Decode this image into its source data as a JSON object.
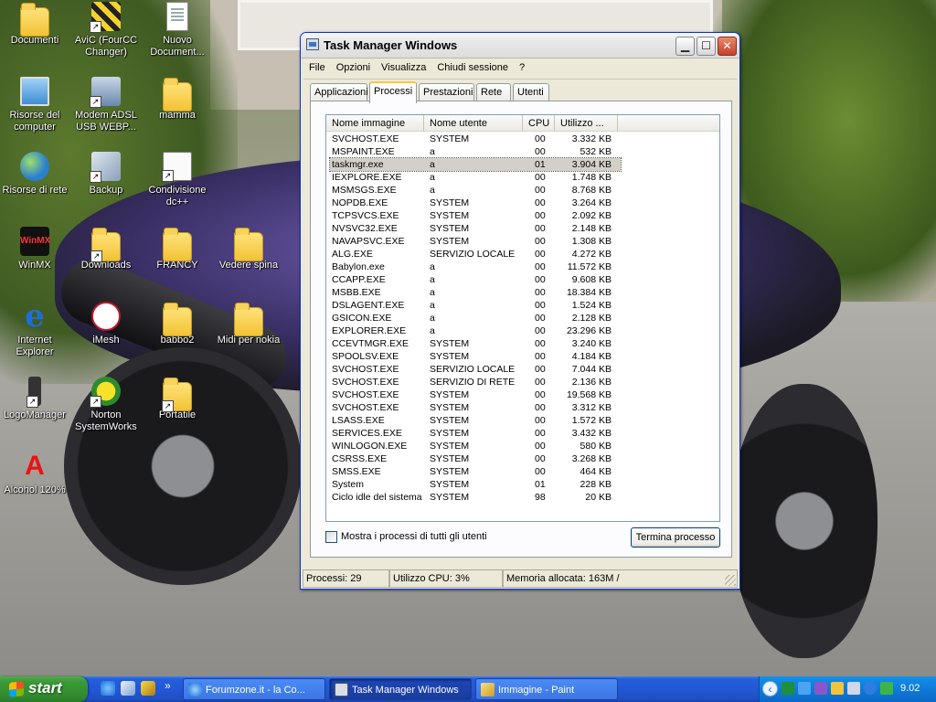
{
  "desktop": {
    "icons": [
      {
        "label": "Documenti",
        "icon": "folder-documents-icon"
      },
      {
        "label": "AviC (FourCC Changer)",
        "icon": "avic-icon"
      },
      {
        "label": "Nuovo Document...",
        "icon": "text-document-icon"
      },
      {
        "label": "Risorse del computer",
        "icon": "my-computer-icon"
      },
      {
        "label": "Modem ADSL USB WEBP...",
        "icon": "modem-icon"
      },
      {
        "label": "mamma",
        "icon": "folder-icon"
      },
      {
        "label": "Risorse di rete",
        "icon": "network-places-icon"
      },
      {
        "label": "Backup",
        "icon": "backup-icon"
      },
      {
        "label": "Condivisione dc++",
        "icon": "share-icon"
      },
      {
        "label": "WinMX",
        "icon": "winmx-icon"
      },
      {
        "label": "Downloads",
        "icon": "folder-icon"
      },
      {
        "label": "FRANCY",
        "icon": "folder-icon"
      },
      {
        "label": "Vedere spina",
        "icon": "folder-icon"
      },
      {
        "label": "Internet Explorer",
        "icon": "internet-explorer-icon"
      },
      {
        "label": "iMesh",
        "icon": "imesh-icon"
      },
      {
        "label": "babbo2",
        "icon": "folder-icon"
      },
      {
        "label": "Midi per nokia",
        "icon": "folder-icon"
      },
      {
        "label": "LogoManager",
        "icon": "phone-icon"
      },
      {
        "label": "Norton SystemWorks",
        "icon": "norton-icon"
      },
      {
        "label": "Portatile",
        "icon": "folder-icon"
      },
      {
        "label": "Alcohol 120%",
        "icon": "alcohol-icon"
      }
    ]
  },
  "window": {
    "title": "Task Manager Windows",
    "menu": [
      "File",
      "Opzioni",
      "Visualizza",
      "Chiudi sessione",
      "?"
    ],
    "tabs": [
      "Applicazioni",
      "Processi",
      "Prestazioni",
      "Rete",
      "Utenti"
    ],
    "active_tab": "Processi",
    "columns": [
      "Nome immagine",
      "Nome utente",
      "CPU",
      "Utilizzo ..."
    ],
    "processes": [
      {
        "name": "SVCHOST.EXE",
        "user": "SYSTEM",
        "cpu": "00",
        "mem": "3.332 KB"
      },
      {
        "name": "MSPAINT.EXE",
        "user": "a",
        "cpu": "00",
        "mem": "532 KB"
      },
      {
        "name": "taskmgr.exe",
        "user": "a",
        "cpu": "01",
        "mem": "3.904 KB",
        "selected": true
      },
      {
        "name": "IEXPLORE.EXE",
        "user": "a",
        "cpu": "00",
        "mem": "1.748 KB"
      },
      {
        "name": "MSMSGS.EXE",
        "user": "a",
        "cpu": "00",
        "mem": "8.768 KB"
      },
      {
        "name": "NOPDB.EXE",
        "user": "SYSTEM",
        "cpu": "00",
        "mem": "3.264 KB"
      },
      {
        "name": "TCPSVCS.EXE",
        "user": "SYSTEM",
        "cpu": "00",
        "mem": "2.092 KB"
      },
      {
        "name": "NVSVC32.EXE",
        "user": "SYSTEM",
        "cpu": "00",
        "mem": "2.148 KB"
      },
      {
        "name": "NAVAPSVC.EXE",
        "user": "SYSTEM",
        "cpu": "00",
        "mem": "1.308 KB"
      },
      {
        "name": "ALG.EXE",
        "user": "SERVIZIO LOCALE",
        "cpu": "00",
        "mem": "4.272 KB"
      },
      {
        "name": "Babylon.exe",
        "user": "a",
        "cpu": "00",
        "mem": "11.572 KB"
      },
      {
        "name": "CCAPP.EXE",
        "user": "a",
        "cpu": "00",
        "mem": "9.608 KB"
      },
      {
        "name": "MSBB.EXE",
        "user": "a",
        "cpu": "00",
        "mem": "18.384 KB"
      },
      {
        "name": "DSLAGENT.EXE",
        "user": "a",
        "cpu": "00",
        "mem": "1.524 KB"
      },
      {
        "name": "GSICON.EXE",
        "user": "a",
        "cpu": "00",
        "mem": "2.128 KB"
      },
      {
        "name": "EXPLORER.EXE",
        "user": "a",
        "cpu": "00",
        "mem": "23.296 KB"
      },
      {
        "name": "CCEVTMGR.EXE",
        "user": "SYSTEM",
        "cpu": "00",
        "mem": "3.240 KB"
      },
      {
        "name": "SPOOLSV.EXE",
        "user": "SYSTEM",
        "cpu": "00",
        "mem": "4.184 KB"
      },
      {
        "name": "SVCHOST.EXE",
        "user": "SERVIZIO LOCALE",
        "cpu": "00",
        "mem": "7.044 KB"
      },
      {
        "name": "SVCHOST.EXE",
        "user": "SERVIZIO DI RETE",
        "cpu": "00",
        "mem": "2.136 KB"
      },
      {
        "name": "SVCHOST.EXE",
        "user": "SYSTEM",
        "cpu": "00",
        "mem": "19.568 KB"
      },
      {
        "name": "SVCHOST.EXE",
        "user": "SYSTEM",
        "cpu": "00",
        "mem": "3.312 KB"
      },
      {
        "name": "LSASS.EXE",
        "user": "SYSTEM",
        "cpu": "00",
        "mem": "1.572 KB"
      },
      {
        "name": "SERVICES.EXE",
        "user": "SYSTEM",
        "cpu": "00",
        "mem": "3.432 KB"
      },
      {
        "name": "WINLOGON.EXE",
        "user": "SYSTEM",
        "cpu": "00",
        "mem": "580 KB"
      },
      {
        "name": "CSRSS.EXE",
        "user": "SYSTEM",
        "cpu": "00",
        "mem": "3.268 KB"
      },
      {
        "name": "SMSS.EXE",
        "user": "SYSTEM",
        "cpu": "00",
        "mem": "464 KB"
      },
      {
        "name": "System",
        "user": "SYSTEM",
        "cpu": "01",
        "mem": "228 KB"
      },
      {
        "name": "Ciclo idle del sistema",
        "user": "SYSTEM",
        "cpu": "98",
        "mem": "20 KB"
      }
    ],
    "show_all_label": "Mostra i processi di tutti gli utenti",
    "end_process_label": "Termina processo",
    "status": {
      "processes": "Processi: 29",
      "cpu": "Utilizzo CPU: 3%",
      "memory": "Memoria allocata: 163M /"
    }
  },
  "taskbar": {
    "start_label": "start",
    "quick_launch": [
      "internet-explorer-icon",
      "media-icon",
      "winamp-icon"
    ],
    "overflow": "»",
    "tasks": [
      {
        "label": "Forumzone.it - la Co...",
        "icon": "ie-page-icon"
      },
      {
        "label": "Task Manager Windows",
        "icon": "task-manager-icon",
        "active": true
      },
      {
        "label": "Immagine - Paint",
        "icon": "paint-icon"
      }
    ],
    "clock": "9.02"
  }
}
